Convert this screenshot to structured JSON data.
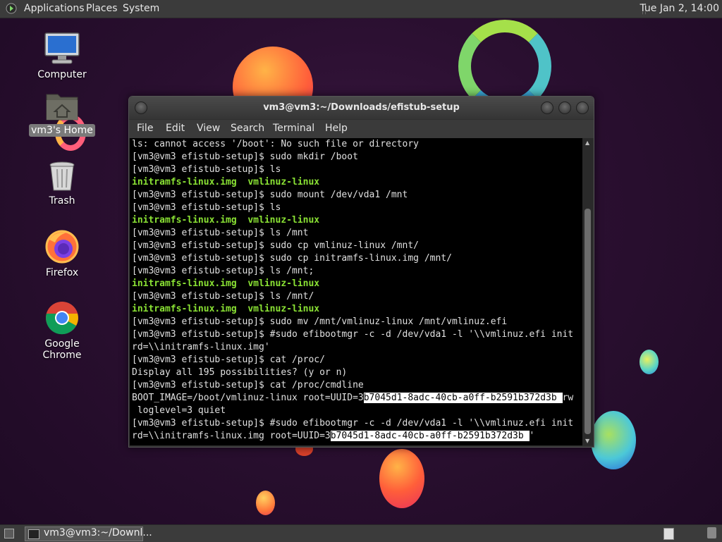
{
  "top_panel": {
    "menus": [
      "Applications",
      "Places",
      "System"
    ],
    "clock": "Tue Jan  2, 14:00"
  },
  "desktop": {
    "icons": [
      {
        "label": "Computer",
        "icon": "computer-icon"
      },
      {
        "label": "vm3's Home",
        "icon": "home-folder-icon"
      },
      {
        "label": "Trash",
        "icon": "trash-icon"
      },
      {
        "label": "Firefox",
        "icon": "firefox-icon"
      },
      {
        "label": "Google Chrome",
        "icon": "chrome-icon"
      }
    ]
  },
  "terminal": {
    "title": "vm3@vm3:~/Downloads/efistub-setup",
    "menu": [
      "File",
      "Edit",
      "View",
      "Search",
      "Terminal",
      "Help"
    ],
    "lines": [
      "ls: cannot access '/boot': No such file or directory",
      "[vm3@vm3 efistub-setup]$ sudo mkdir /boot",
      "[vm3@vm3 efistub-setup]$ ls",
      "initramfs-linux.img  vmlinuz-linux",
      "[vm3@vm3 efistub-setup]$ sudo mount /dev/vda1 /mnt",
      "[vm3@vm3 efistub-setup]$ ls",
      "initramfs-linux.img  vmlinuz-linux",
      "[vm3@vm3 efistub-setup]$ ls /mnt",
      "[vm3@vm3 efistub-setup]$ sudo cp vmlinuz-linux /mnt/",
      "[vm3@vm3 efistub-setup]$ sudo cp initramfs-linux.img /mnt/",
      "[vm3@vm3 efistub-setup]$ ls /mnt;",
      "initramfs-linux.img  vmlinuz-linux",
      "[vm3@vm3 efistub-setup]$ ls /mnt/",
      "initramfs-linux.img  vmlinuz-linux",
      "[vm3@vm3 efistub-setup]$ sudo mv /mnt/vmlinuz-linux /mnt/vmlinuz.efi",
      "[vm3@vm3 efistub-setup]$ #sudo efibootmgr -c -d /dev/vda1 -l '\\\\vmlinuz.efi init",
      "rd=\\\\initramfs-linux.img'",
      "[vm3@vm3 efistub-setup]$ cat /proc/",
      "Display all 195 possibilities? (y or n)",
      "[vm3@vm3 efistub-setup]$ cat /proc/cmdline",
      "BOOT_IMAGE=/boot/vmlinuz-linux root=UUID=3",
      " loglevel=3 quiet",
      "[vm3@vm3 efistub-setup]$ #sudo efibootmgr -c -d /dev/vda1 -l '\\\\vmlinuz.efi init",
      "rd=\\\\initramfs-linux.img root=UUID=3"
    ],
    "uuid_selected_1": "b7045d1-8adc-40cb-a0ff-b2591b372d3b ",
    "line20_tail": "rw",
    "uuid_selected_2": "b7045d1-8adc-40cb-a0ff-b2591b372d3b ",
    "line23_tail": "'"
  },
  "bottom_panel": {
    "task_label": "vm3@vm3:~/Downl..."
  }
}
